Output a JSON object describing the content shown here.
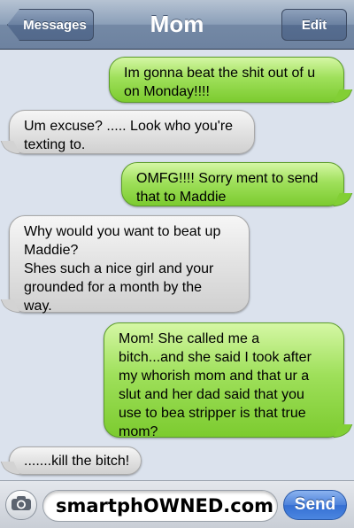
{
  "navbar": {
    "back_label": "Messages",
    "title": "Mom",
    "edit_label": "Edit"
  },
  "messages": [
    {
      "side": "sent",
      "lines": [
        "Im gonna beat the shit out of u",
        "on Monday!!!!"
      ]
    },
    {
      "side": "received",
      "lines": [
        "Um excuse? ..... Look who you're",
        "texting to."
      ]
    },
    {
      "side": "sent",
      "lines": [
        "OMFG!!!! Sorry ment to send",
        "that to Maddie"
      ]
    },
    {
      "side": "received",
      "lines": [
        "Why would you want to beat up",
        "Maddie?",
        "Shes such a nice girl and your",
        "grounded for a month by the",
        "way."
      ]
    },
    {
      "side": "sent",
      "lines": [
        "Mom! She called me a",
        "bitch...and she said I took after",
        "my whorish mom and that ur a",
        "slut and her dad said that you",
        "use to bea stripper is that true",
        "mom?"
      ]
    },
    {
      "side": "received",
      "lines": [
        ".......kill the bitch!"
      ]
    }
  ],
  "composer": {
    "input_value": "smartphOWNED.com",
    "send_label": "Send",
    "camera_icon": "camera-icon"
  },
  "colors": {
    "sent_bubble": "#8ad63d",
    "received_bubble": "#dedede",
    "navbar": "#7d91ad",
    "send_button": "#3f78d8"
  }
}
